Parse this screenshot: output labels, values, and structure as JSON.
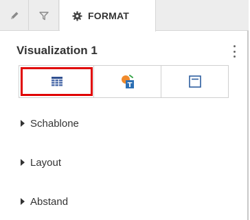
{
  "tabs": {
    "pencil": {
      "icon": "pencil-icon"
    },
    "filter": {
      "icon": "filter-icon"
    },
    "format": {
      "icon": "gear-icon",
      "label": "FORMAT"
    }
  },
  "panel": {
    "title": "Visualization 1",
    "more_icon": "vertical-ellipsis-icon"
  },
  "viz_buttons": [
    {
      "icon": "table-grid-icon",
      "selected": true
    },
    {
      "icon": "format-text-icon",
      "selected": false
    },
    {
      "icon": "window-properties-icon",
      "selected": false
    }
  ],
  "sections": [
    {
      "label": "Schablone"
    },
    {
      "label": "Layout"
    },
    {
      "label": "Abstand"
    }
  ],
  "colors": {
    "selection_border": "#e00000",
    "table_icon": "#2f4f8f",
    "accent_orange": "#f08a2c",
    "accent_blue": "#2c6fb4",
    "accent_green": "#3aa54a"
  }
}
